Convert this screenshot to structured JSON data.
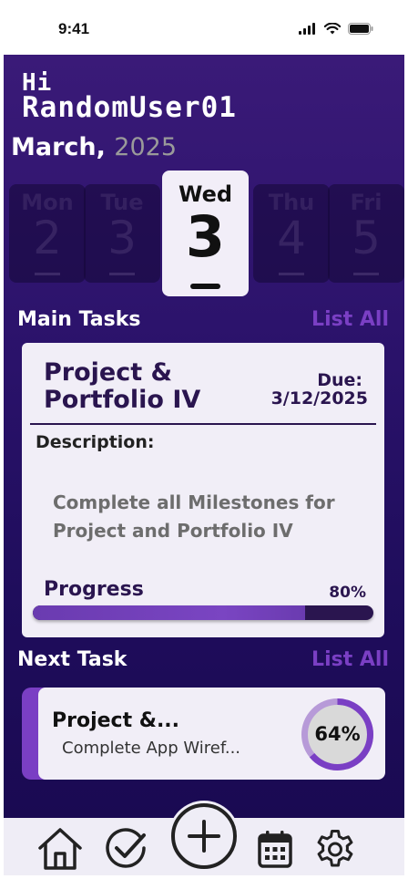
{
  "status_bar": {
    "time": "9:41",
    "icons": [
      "signal-icon",
      "wifi-icon",
      "battery-icon"
    ]
  },
  "greeting": {
    "hi": "Hi",
    "username": "RandomUser01"
  },
  "calendar": {
    "month": "March,",
    "year": "2025",
    "days": [
      {
        "name": "Mon",
        "number": "2",
        "active": false
      },
      {
        "name": "Tue",
        "number": "3",
        "active": false
      },
      {
        "name": "Wed",
        "number": "3",
        "active": true
      },
      {
        "name": "Thu",
        "number": "4",
        "active": false
      },
      {
        "name": "Fri",
        "number": "5",
        "active": false
      }
    ]
  },
  "main_tasks": {
    "section_title": "Main Tasks",
    "list_all_label": "List All",
    "task": {
      "title": "Project & Portfolio IV",
      "due_label": "Due:",
      "due_date": "3/12/2025",
      "description_label": "Description:",
      "description": "Complete all Milestones for Project and Portfolio IV",
      "progress_label": "Progress",
      "progress_text": "80%",
      "progress_value": 0.8
    }
  },
  "next_task": {
    "section_title": "Next Task",
    "list_all_label": "List All",
    "task": {
      "title": "Project &...",
      "description": "Complete App Wiref...",
      "progress_text": "64%",
      "progress_value": 0.64
    }
  },
  "nav": {
    "items": [
      "home-icon",
      "check-circle-icon",
      "add-icon",
      "calendar-icon",
      "settings-icon"
    ]
  },
  "colors": {
    "background_top": "#3a1a78",
    "background_bottom": "#1a0a52",
    "accent": "#7a3fc4",
    "card": "#f1eef7",
    "text_dark": "#2a154f"
  }
}
